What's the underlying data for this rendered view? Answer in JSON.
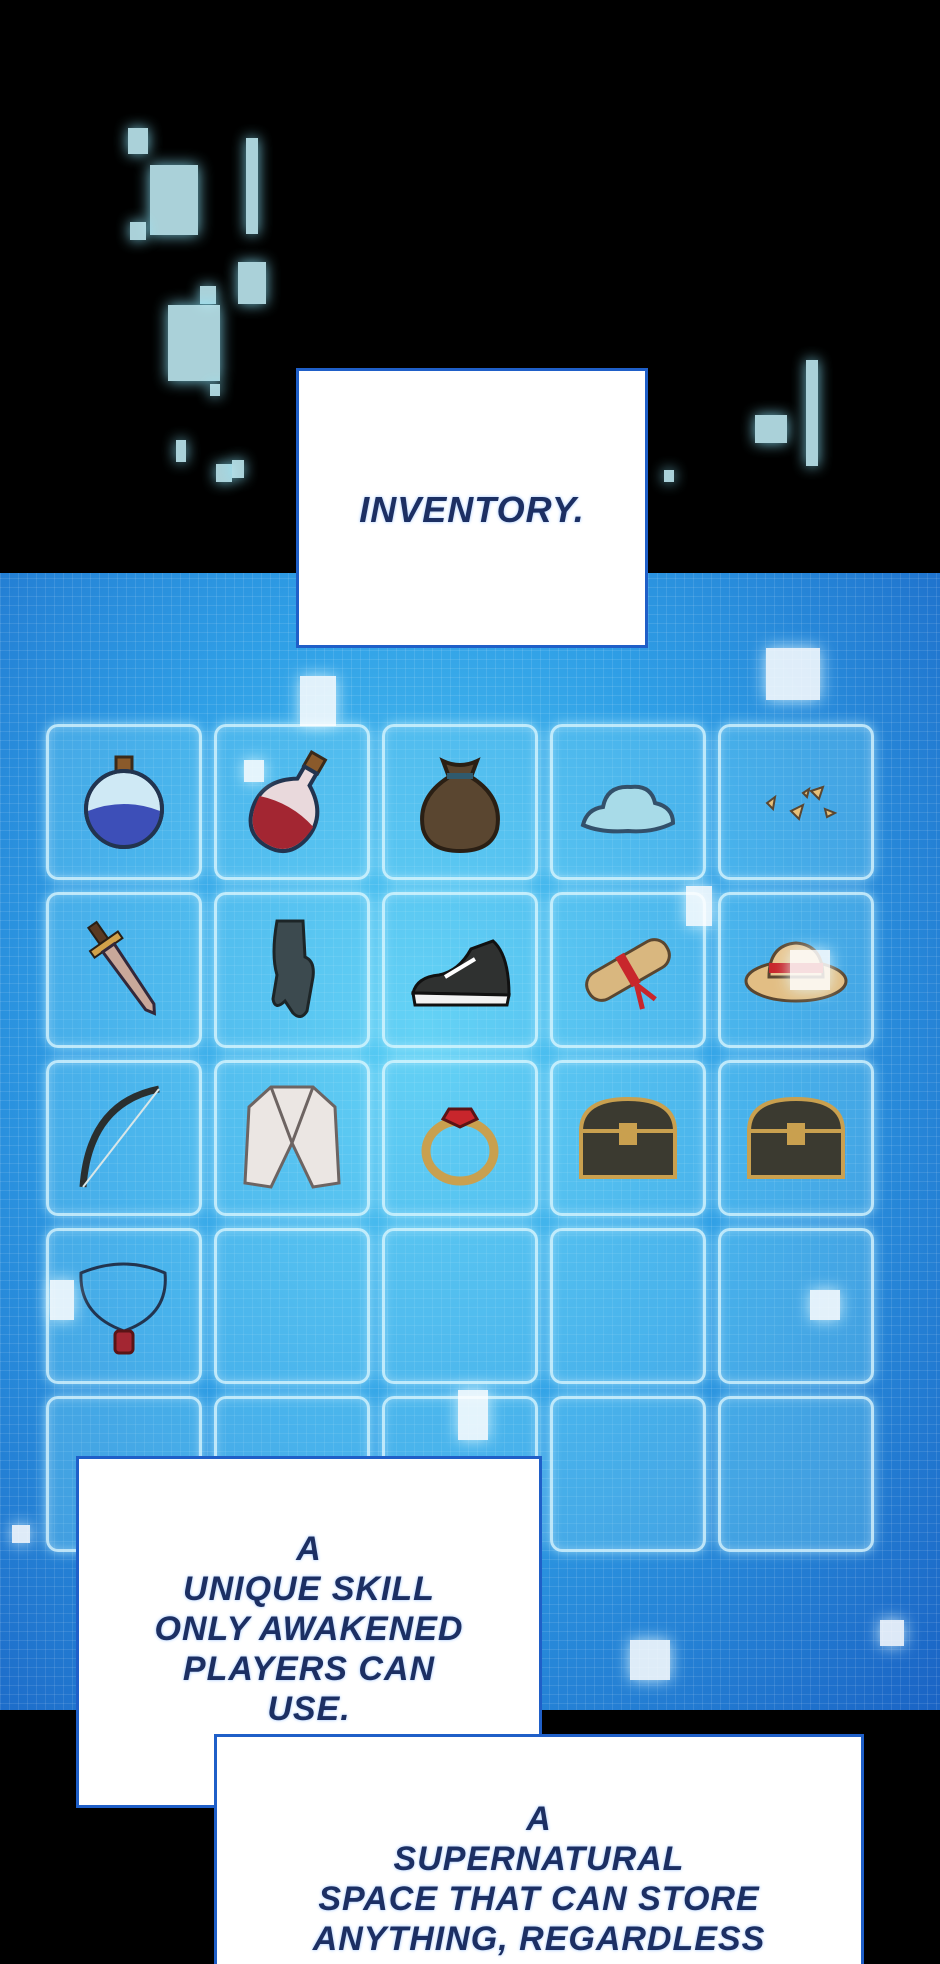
{
  "captions": {
    "title": "INVENTORY.",
    "caption1_lines": [
      "A",
      "UNIQUE SKILL",
      "ONLY AWAKENED",
      "PLAYERS CAN",
      "USE."
    ],
    "caption2_lines": [
      "A",
      "SUPERNATURAL",
      "SPACE THAT CAN STORE",
      "ANYTHING, REGARDLESS"
    ]
  },
  "inventory": {
    "rows": 5,
    "cols": 5,
    "items": [
      "blue-potion-icon",
      "red-potion-icon",
      "coin-pouch-icon",
      "slime-puddle-icon",
      "shards-icon",
      "sword-icon",
      "glove-icon",
      "sneaker-icon",
      "scroll-icon",
      "straw-hat-icon",
      "bow-icon",
      "jacket-icon",
      "ruby-ring-icon",
      "treasure-chest-icon",
      "treasure-chest-icon",
      "necklace-icon",
      "",
      "",
      "",
      "",
      "",
      "",
      "",
      "",
      ""
    ]
  },
  "colors": {
    "panel": "#2f9fe6",
    "caption_border": "#1f5fc8",
    "caption_text": "#1c2f63"
  }
}
